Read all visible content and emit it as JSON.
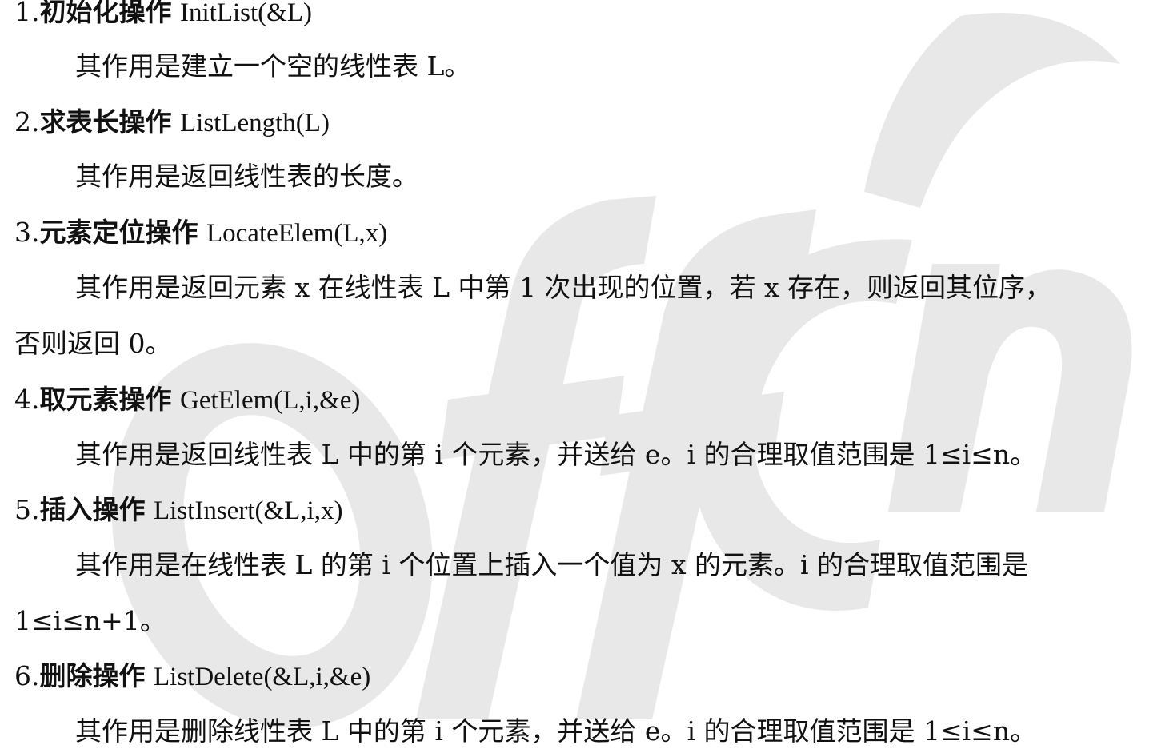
{
  "operations": [
    {
      "number": "1.",
      "title": "初始化操作",
      "signature": "InitList(&L)",
      "description": [
        "其作用是建立一个空的线性表 L。"
      ]
    },
    {
      "number": "2.",
      "title": "求表长操作",
      "signature": "ListLength(L)",
      "description": [
        "其作用是返回线性表的长度。"
      ]
    },
    {
      "number": "3.",
      "title": "元素定位操作",
      "signature": "LocateElem(L,x)",
      "description": [
        "其作用是返回元素 x 在线性表 L 中第 1 次出现的位置，若 x 存在，则返回其位序，",
        "否则返回 0。"
      ]
    },
    {
      "number": "4.",
      "title": "取元素操作",
      "signature": "GetElem(L,i,&e)",
      "description": [
        "其作用是返回线性表 L 中的第 i 个元素，并送给 e。i 的合理取值范围是 1≤i≤n。"
      ]
    },
    {
      "number": "5.",
      "title": "插入操作",
      "signature": "ListInsert(&L,i,x)",
      "description": [
        "其作用是在线性表 L 的第 i 个位置上插入一个值为 x 的元素。i 的合理取值范围是",
        "1≤i≤n+1。"
      ]
    },
    {
      "number": "6.",
      "title": "删除操作",
      "signature": "ListDelete(&L,i,&e)",
      "description": [
        "其作用是删除线性表 L 中的第 i 个元素，并送给 e。i 的合理取值范围是 1≤i≤n。"
      ]
    }
  ],
  "watermark": {
    "logo_text": "offcn",
    "color": "#e6e6e6"
  }
}
